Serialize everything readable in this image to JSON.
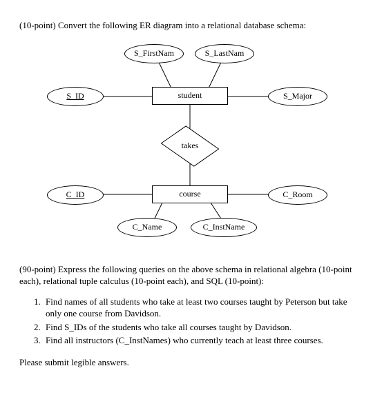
{
  "prompt1": "(10-point) Convert the following ER diagram into a relational database schema:",
  "er": {
    "entities": {
      "student": {
        "label": "student"
      },
      "course": {
        "label": "course"
      }
    },
    "relationship": {
      "takes": {
        "label": "takes",
        "between": [
          "student",
          "course"
        ],
        "cardinality": "many-to-many"
      }
    },
    "attributes": {
      "S_ID": {
        "of": "student",
        "label": "S_ID",
        "key": true
      },
      "S_FirstNam": {
        "of": "student",
        "label": "S_FirstNam",
        "key": false
      },
      "S_LastNam": {
        "of": "student",
        "label": "S_LastNam",
        "key": false
      },
      "S_Major": {
        "of": "student",
        "label": "S_Major",
        "key": false
      },
      "C_ID": {
        "of": "course",
        "label": "C_ID",
        "key": true
      },
      "C_Name": {
        "of": "course",
        "label": "C_Name",
        "key": false
      },
      "C_InstName": {
        "of": "course",
        "label": "C_InstName",
        "key": false
      },
      "C_Room": {
        "of": "course",
        "label": "C_Room",
        "key": false
      }
    }
  },
  "prompt2": "(90-point) Express the following queries on the above schema in relational algebra (10-point each), relational tuple calculus (10-point each), and SQL (10-point):",
  "queries": [
    "Find names of all students who take at least two courses taught by Peterson but take only one course from Davidson.",
    "Find S_IDs of the students who take all courses taught by Davidson.",
    "Find all instructors (C_InstNames) who currently teach at least three courses."
  ],
  "footer": "Please submit legible answers."
}
